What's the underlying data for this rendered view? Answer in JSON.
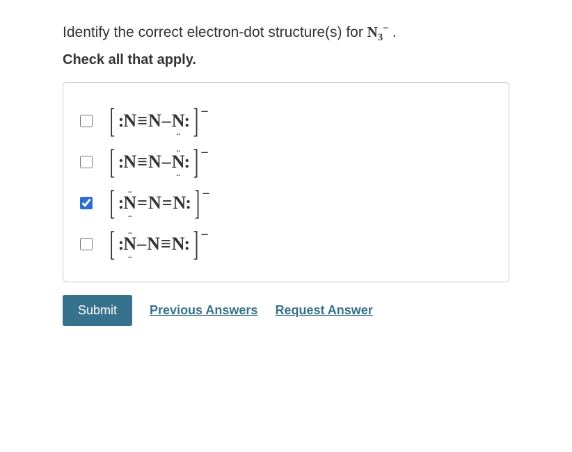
{
  "question_prefix": "Identify the correct electron-dot structure(s) for ",
  "formula_base": "N",
  "formula_sub": "3",
  "formula_charge": "−",
  "question_suffix": ".",
  "instruction": "Check all that apply.",
  "options": [
    {
      "checked": false,
      "left_lone": ":",
      "n1_top": "",
      "n1_bot": "",
      "bond1": "≡",
      "n2_top": "",
      "n2_bot": "",
      "bond2": "–",
      "n3_top": "",
      "n3_bot": "..",
      "right_lone": ":",
      "charge": "−"
    },
    {
      "checked": false,
      "left_lone": ":",
      "n1_top": "",
      "n1_bot": "",
      "bond1": "≡",
      "n2_top": "",
      "n2_bot": "",
      "bond2": "–",
      "n3_top": "..",
      "n3_bot": "..",
      "right_lone": ":",
      "charge": "−"
    },
    {
      "checked": true,
      "left_lone": ":",
      "n1_top": "..",
      "n1_bot": "..",
      "bond1": "=",
      "n2_top": "",
      "n2_bot": "",
      "bond2": "=",
      "n3_top": "",
      "n3_bot": "",
      "right_lone": ":",
      "charge": "−"
    },
    {
      "checked": false,
      "left_lone": ":",
      "n1_top": "..",
      "n1_bot": "..",
      "bond1": "–",
      "n2_top": "",
      "n2_bot": "",
      "bond2": "≡",
      "n3_top": "",
      "n3_bot": "",
      "right_lone": ":",
      "charge": "−"
    }
  ],
  "buttons": {
    "submit": "Submit",
    "previous": "Previous Answers",
    "request": "Request Answer"
  }
}
